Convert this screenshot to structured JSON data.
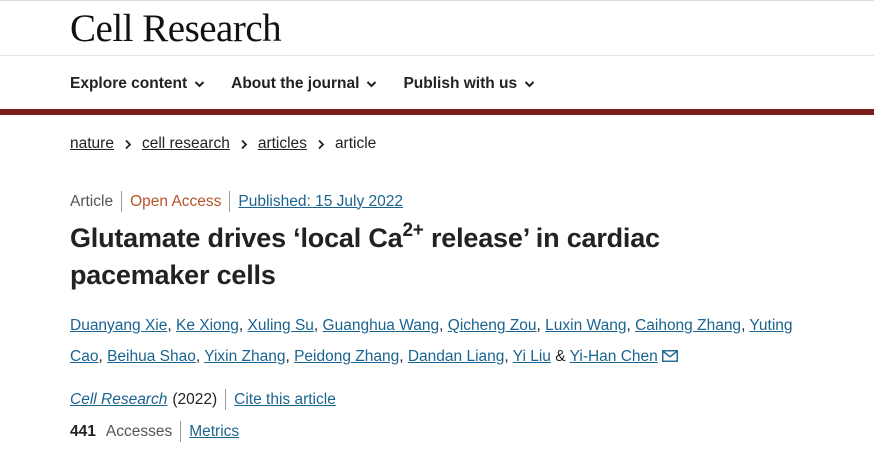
{
  "brand": {
    "title": "Cell Research"
  },
  "nav": {
    "items": [
      {
        "label": "Explore content"
      },
      {
        "label": "About the journal"
      },
      {
        "label": "Publish with us"
      }
    ]
  },
  "breadcrumb": {
    "items": [
      {
        "label": "nature"
      },
      {
        "label": "cell research"
      },
      {
        "label": "articles"
      },
      {
        "label": "article"
      }
    ]
  },
  "article": {
    "type": "Article",
    "access": "Open Access",
    "published": "Published: 15 July 2022",
    "title_before": "Glutamate drives ‘local Ca",
    "title_sup": "2+",
    "title_after": " release’ in cardiac pacemaker cells",
    "authors": [
      "Duanyang Xie",
      "Ke Xiong",
      "Xuling Su",
      "Guanghua Wang",
      "Qicheng Zou",
      "Luxin Wang",
      "Caihong Zhang",
      "Yuting Cao",
      "Beihua Shao",
      "Yixin Zhang",
      "Peidong Zhang",
      "Dandan Liang",
      "Yi Liu",
      "Yi-Han Chen"
    ],
    "author_sep": ",",
    "author_and": "&",
    "journal": "Cell Research",
    "year": "(2022)",
    "cite_label": "Cite this article",
    "accesses_count": "441",
    "accesses_label": "Accesses",
    "metrics_label": "Metrics"
  },
  "colors": {
    "link": "#1b6490",
    "open_access": "#b5532b",
    "header_bar": "#7a1f1f",
    "text": "#222222"
  },
  "icons": {
    "nav_chevron": "chevron-down-icon",
    "breadcrumb_separator": "chevron-right-icon",
    "corresponding_author": "mail-icon"
  }
}
